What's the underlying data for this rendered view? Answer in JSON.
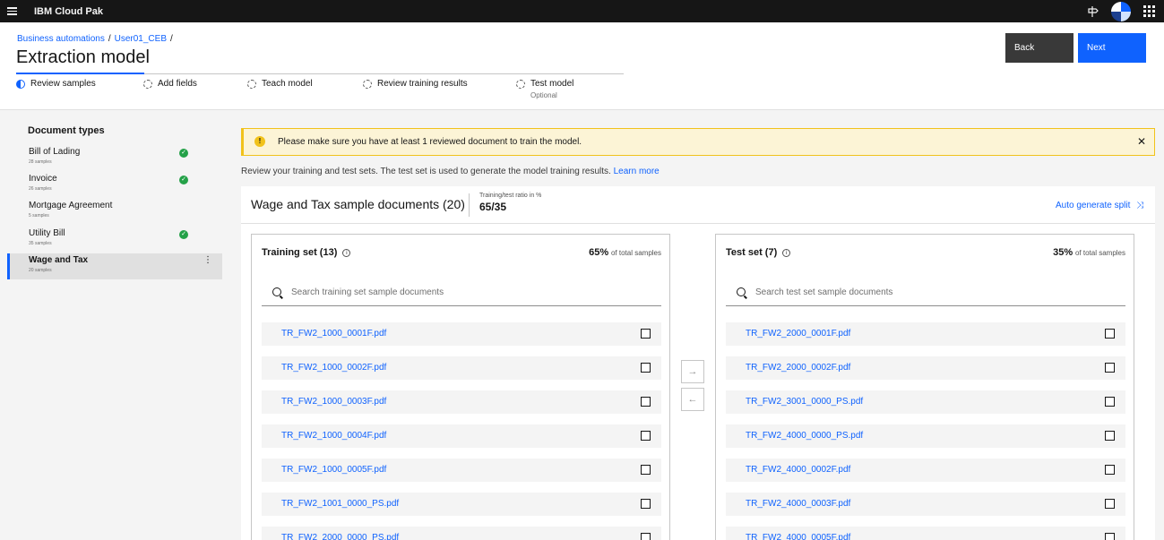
{
  "topbar": {
    "brand": "IBM Cloud Pak",
    "menu_icon": "hamburger-icon",
    "help_icon": "signpost-icon",
    "apps_icon": "app-switcher-icon"
  },
  "header": {
    "breadcrumbs": [
      "Business automations",
      "User01_CEB"
    ],
    "sep": "/",
    "title": "Extraction model",
    "back_label": "Back",
    "next_label": "Next",
    "steps": [
      {
        "label": "Review samples",
        "state": "current",
        "sub": ""
      },
      {
        "label": "Add fields",
        "state": "incomplete",
        "sub": ""
      },
      {
        "label": "Teach model",
        "state": "incomplete",
        "sub": ""
      },
      {
        "label": "Review training results",
        "state": "incomplete",
        "sub": ""
      },
      {
        "label": "Test model",
        "state": "incomplete",
        "sub": "Optional"
      }
    ]
  },
  "sidebar": {
    "title": "Document types",
    "check_glyph": "✓",
    "more_glyph": "⋮",
    "items": [
      {
        "name": "Bill of Lading",
        "count": "28 samples",
        "reviewed": true
      },
      {
        "name": "Invoice",
        "count": "26 samples",
        "reviewed": true
      },
      {
        "name": "Mortgage Agreement",
        "count": "5 samples",
        "reviewed": false
      },
      {
        "name": "Utility Bill",
        "count": "35 samples",
        "reviewed": true
      },
      {
        "name": "Wage and Tax",
        "count": "20 samples",
        "reviewed": false,
        "active": true
      }
    ]
  },
  "notice": {
    "icon": "!",
    "message": "Please make sure you have at least 1 reviewed document to train the model.",
    "close": "✕"
  },
  "intro": {
    "text": "Review your training and test sets. The test set is used to generate the model training results.",
    "link": "Learn more"
  },
  "panel": {
    "title": "Wage and Tax sample documents (20)",
    "ratio_label": "Training/test ratio in %",
    "ratio_value": "65/35",
    "autogen_label": "Auto generate split",
    "autogen_icon": "⤨"
  },
  "training": {
    "title": "Training set (13)",
    "info_icon": "i",
    "percent": "65%",
    "percent_suffix": "of total samples",
    "search_placeholder": "Search training set sample documents",
    "files": [
      "TR_FW2_1000_0001F.pdf",
      "TR_FW2_1000_0002F.pdf",
      "TR_FW2_1000_0003F.pdf",
      "TR_FW2_1000_0004F.pdf",
      "TR_FW2_1000_0005F.pdf",
      "TR_FW2_1001_0000_PS.pdf",
      "TR_FW2_2000_0000_PS.pdf"
    ]
  },
  "test": {
    "title": "Test set (7)",
    "info_icon": "i",
    "percent": "35%",
    "percent_suffix": "of total samples",
    "search_placeholder": "Search test set sample documents",
    "files": [
      "TR_FW2_2000_0001F.pdf",
      "TR_FW2_2000_0002F.pdf",
      "TR_FW2_3001_0000_PS.pdf",
      "TR_FW2_4000_0000_PS.pdf",
      "TR_FW2_4000_0002F.pdf",
      "TR_FW2_4000_0003F.pdf",
      "TR_FW2_4000_0005F.pdf"
    ]
  },
  "move": {
    "right_glyph": "→",
    "left_glyph": "←"
  }
}
